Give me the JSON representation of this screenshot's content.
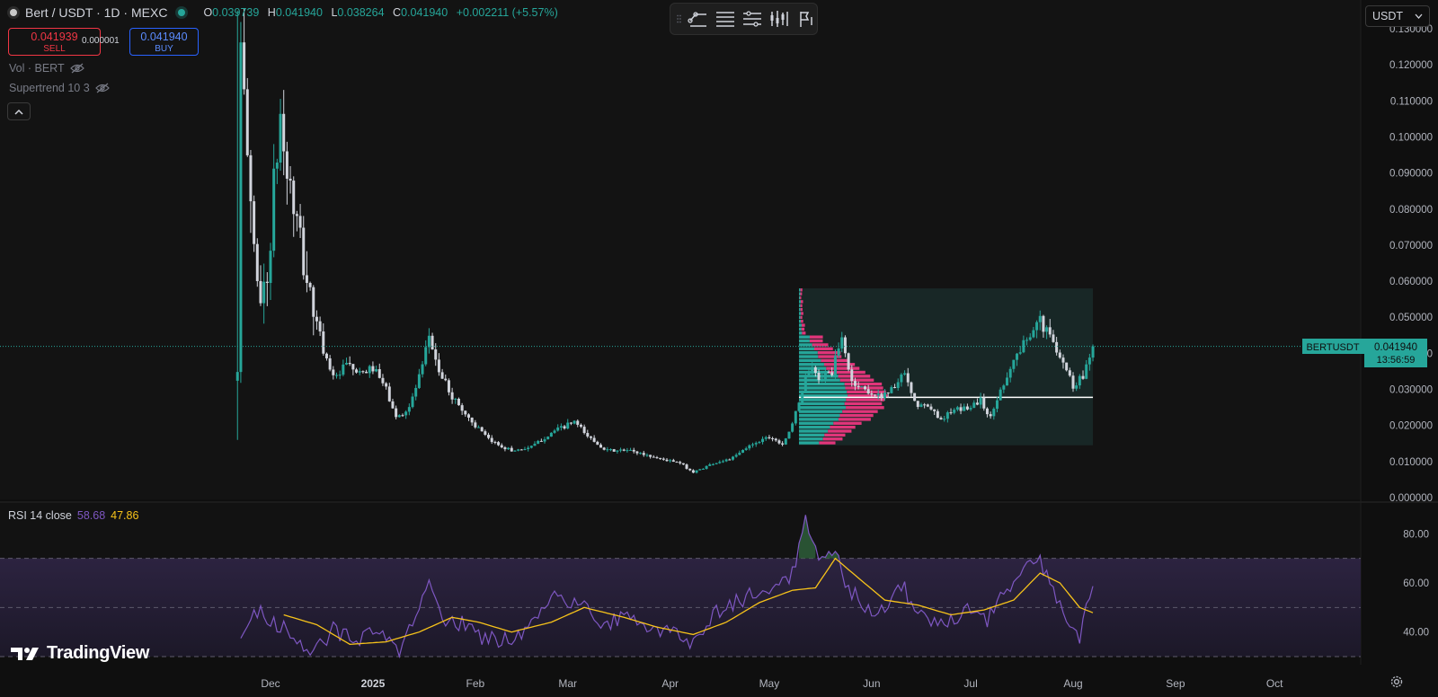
{
  "header": {
    "symbol": "Bert / USDT · 1D · MEXC",
    "ohlc": [
      {
        "label": "O",
        "value": "0.039739"
      },
      {
        "label": "H",
        "value": "0.041940"
      },
      {
        "label": "L",
        "value": "0.038264"
      },
      {
        "label": "C",
        "value": "0.041940"
      },
      {
        "label": "",
        "value": "+0.002211 (+5.57%)"
      }
    ]
  },
  "trade": {
    "sell_price": "0.041939",
    "sell_label": "SELL",
    "spread": "0.000001",
    "buy_price": "0.041940",
    "buy_label": "BUY"
  },
  "indicators": {
    "volume": "Vol · BERT",
    "supertrend": "Supertrend 10 3"
  },
  "currency": "USDT",
  "price_label": {
    "symbol": "BERTUSDT",
    "price": "0.041940",
    "countdown": "13:56:59"
  },
  "rsi": {
    "label": "RSI 14 close",
    "rsi_value": "58.68",
    "ma_value": "47.86"
  },
  "brand": "TradingView",
  "colors": {
    "up": "#26a69a",
    "down": "#d1d4dc",
    "rsi_line": "#7e57c2",
    "rsi_ma": "#f7c31a",
    "vp_up": "#26a69a",
    "vp_down": "#e0357a",
    "background": "#0f0f0f"
  },
  "chart_data": [
    {
      "type": "candlestick",
      "title": "Bert / USDT · 1D · MEXC",
      "y_axis_ticks": [
        "0.000000",
        "0.010000",
        "0.020000",
        "0.030000",
        "0.040000",
        "0.050000",
        "0.060000",
        "0.070000",
        "0.080000",
        "0.090000",
        "0.100000",
        "0.110000",
        "0.120000",
        "0.130000"
      ],
      "x_axis_ticks": [
        "Dec",
        "2025",
        "Feb",
        "Mar",
        "Apr",
        "May",
        "Jun",
        "Jul",
        "Aug",
        "Sep",
        "Oct"
      ],
      "ylim": [
        0,
        0.13
      ],
      "xlim": [
        "2024-11-05",
        "2025-10-15"
      ],
      "grid": false,
      "last_price": 0.04194,
      "anchors": [
        [
          "2024-11-21",
          0.036
        ],
        [
          "2024-11-22",
          0.12
        ],
        [
          "2024-11-24",
          0.095
        ],
        [
          "2024-11-26",
          0.07
        ],
        [
          "2024-11-28",
          0.055
        ],
        [
          "2024-11-30",
          0.06
        ],
        [
          "2024-12-02",
          0.085
        ],
        [
          "2024-12-04",
          0.105
        ],
        [
          "2024-12-06",
          0.09
        ],
        [
          "2024-12-09",
          0.075
        ],
        [
          "2024-12-12",
          0.06
        ],
        [
          "2024-12-15",
          0.048
        ],
        [
          "2024-12-18",
          0.038
        ],
        [
          "2024-12-21",
          0.033
        ],
        [
          "2024-12-24",
          0.037
        ],
        [
          "2024-12-28",
          0.034
        ],
        [
          "2025-01-01",
          0.036
        ],
        [
          "2025-01-05",
          0.03
        ],
        [
          "2025-01-08",
          0.022
        ],
        [
          "2025-01-12",
          0.025
        ],
        [
          "2025-01-16",
          0.036
        ],
        [
          "2025-01-18",
          0.045
        ],
        [
          "2025-01-21",
          0.035
        ],
        [
          "2025-01-25",
          0.028
        ],
        [
          "2025-01-30",
          0.022
        ],
        [
          "2025-02-05",
          0.016
        ],
        [
          "2025-02-12",
          0.013
        ],
        [
          "2025-02-18",
          0.014
        ],
        [
          "2025-02-24",
          0.018
        ],
        [
          "2025-03-03",
          0.021
        ],
        [
          "2025-03-07",
          0.017
        ],
        [
          "2025-03-13",
          0.013
        ],
        [
          "2025-03-20",
          0.013
        ],
        [
          "2025-03-28",
          0.011
        ],
        [
          "2025-04-04",
          0.0095
        ],
        [
          "2025-04-08",
          0.007
        ],
        [
          "2025-04-14",
          0.0095
        ],
        [
          "2025-04-20",
          0.011
        ],
        [
          "2025-04-26",
          0.015
        ],
        [
          "2025-05-01",
          0.017
        ],
        [
          "2025-05-05",
          0.015
        ],
        [
          "2025-05-08",
          0.02
        ],
        [
          "2025-05-11",
          0.03
        ],
        [
          "2025-05-13",
          0.036
        ],
        [
          "2025-05-16",
          0.033
        ],
        [
          "2025-05-20",
          0.035
        ],
        [
          "2025-05-23",
          0.044
        ],
        [
          "2025-05-26",
          0.032
        ],
        [
          "2025-05-30",
          0.03
        ],
        [
          "2025-06-03",
          0.028
        ],
        [
          "2025-06-07",
          0.03
        ],
        [
          "2025-06-11",
          0.034
        ],
        [
          "2025-06-14",
          0.026
        ],
        [
          "2025-06-18",
          0.025
        ],
        [
          "2025-06-22",
          0.022
        ],
        [
          "2025-06-26",
          0.024
        ],
        [
          "2025-06-30",
          0.025
        ],
        [
          "2025-07-04",
          0.027
        ],
        [
          "2025-07-07",
          0.022
        ],
        [
          "2025-07-10",
          0.03
        ],
        [
          "2025-07-14",
          0.038
        ],
        [
          "2025-07-18",
          0.044
        ],
        [
          "2025-07-21",
          0.05
        ],
        [
          "2025-07-24",
          0.046
        ],
        [
          "2025-07-28",
          0.04
        ],
        [
          "2025-08-01",
          0.031
        ],
        [
          "2025-08-04",
          0.034
        ],
        [
          "2025-08-07",
          0.04194
        ]
      ]
    },
    {
      "type": "histogram",
      "title": "Volume profile",
      "date_range": [
        "2025-05-10",
        "2025-08-07"
      ],
      "price_range": [
        0.0145,
        0.058
      ],
      "point_of_control": 0.0278
    },
    {
      "type": "line",
      "title": "RSI 14 close",
      "y_axis_ticks": [
        "40.00",
        "60.00",
        "80.00"
      ],
      "ylim": [
        30,
        90
      ],
      "bands": [
        30,
        50,
        70
      ],
      "series": [
        {
          "name": "RSI",
          "anchors": [
            [
              "2024-11-22",
              36
            ],
            [
              "2024-11-26",
              50
            ],
            [
              "2024-12-02",
              44
            ],
            [
              "2024-12-08",
              38
            ],
            [
              "2024-12-14",
              32
            ],
            [
              "2024-12-20",
              41
            ],
            [
              "2024-12-27",
              36
            ],
            [
              "2025-01-03",
              40
            ],
            [
              "2025-01-09",
              32
            ],
            [
              "2025-01-13",
              43
            ],
            [
              "2025-01-18",
              59
            ],
            [
              "2025-01-23",
              45
            ],
            [
              "2025-01-29",
              43
            ],
            [
              "2025-02-04",
              37
            ],
            [
              "2025-02-10",
              37
            ],
            [
              "2025-02-17",
              42
            ],
            [
              "2025-02-24",
              56
            ],
            [
              "2025-03-01",
              50
            ],
            [
              "2025-03-06",
              53
            ],
            [
              "2025-03-11",
              42
            ],
            [
              "2025-03-18",
              46
            ],
            [
              "2025-03-25",
              40
            ],
            [
              "2025-04-02",
              42
            ],
            [
              "2025-04-07",
              34
            ],
            [
              "2025-04-13",
              46
            ],
            [
              "2025-04-20",
              52
            ],
            [
              "2025-04-27",
              56
            ],
            [
              "2025-05-03",
              58
            ],
            [
              "2025-05-08",
              64
            ],
            [
              "2025-05-12",
              86
            ],
            [
              "2025-05-16",
              68
            ],
            [
              "2025-05-21",
              72
            ],
            [
              "2025-05-25",
              58
            ],
            [
              "2025-05-31",
              50
            ],
            [
              "2025-06-05",
              48
            ],
            [
              "2025-06-10",
              60
            ],
            [
              "2025-06-15",
              46
            ],
            [
              "2025-06-20",
              44
            ],
            [
              "2025-06-26",
              46
            ],
            [
              "2025-07-01",
              50
            ],
            [
              "2025-07-06",
              45
            ],
            [
              "2025-07-12",
              58
            ],
            [
              "2025-07-17",
              64
            ],
            [
              "2025-07-21",
              70
            ],
            [
              "2025-07-25",
              62
            ],
            [
              "2025-07-30",
              44
            ],
            [
              "2025-08-03",
              38
            ],
            [
              "2025-08-07",
              58.68
            ]
          ]
        },
        {
          "name": "RSI-based MA",
          "anchors": [
            [
              "2024-12-05",
              47
            ],
            [
              "2024-12-15",
              43
            ],
            [
              "2024-12-25",
              35
            ],
            [
              "2025-01-05",
              36
            ],
            [
              "2025-01-15",
              40
            ],
            [
              "2025-01-25",
              46
            ],
            [
              "2025-02-02",
              44
            ],
            [
              "2025-02-12",
              40
            ],
            [
              "2025-02-24",
              44
            ],
            [
              "2025-03-06",
              50
            ],
            [
              "2025-03-18",
              46
            ],
            [
              "2025-03-28",
              42
            ],
            [
              "2025-04-08",
              39
            ],
            [
              "2025-04-18",
              44
            ],
            [
              "2025-04-28",
              52
            ],
            [
              "2025-05-08",
              57
            ],
            [
              "2025-05-15",
              58
            ],
            [
              "2025-05-21",
              70
            ],
            [
              "2025-05-28",
              62
            ],
            [
              "2025-06-05",
              53
            ],
            [
              "2025-06-15",
              51
            ],
            [
              "2025-06-25",
              47
            ],
            [
              "2025-07-05",
              49
            ],
            [
              "2025-07-14",
              53
            ],
            [
              "2025-07-22",
              64
            ],
            [
              "2025-07-28",
              60
            ],
            [
              "2025-08-03",
              50
            ],
            [
              "2025-08-07",
              47.86
            ]
          ]
        }
      ]
    }
  ]
}
